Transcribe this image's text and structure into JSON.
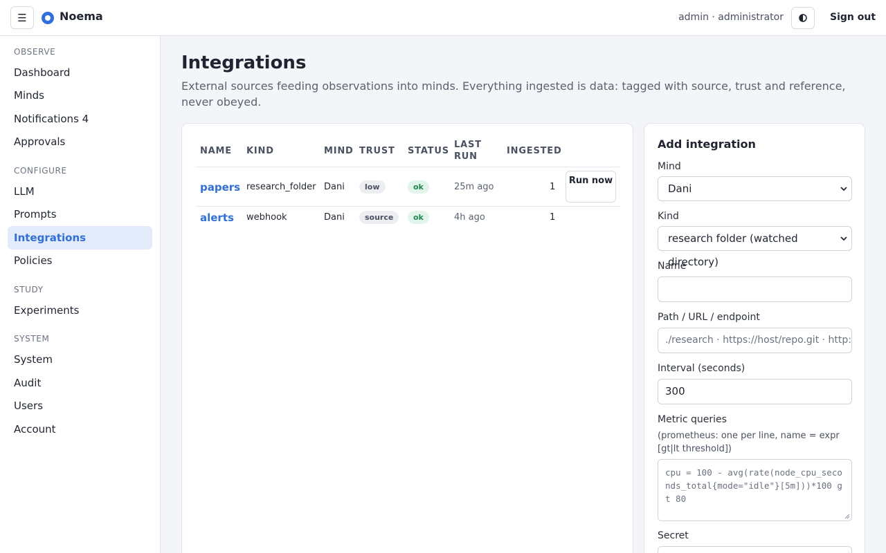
{
  "header": {
    "menu_icon": "hamburger-icon",
    "brand": "Noema",
    "user": "admin · administrator",
    "theme_icon": "contrast-icon",
    "sign_out": "Sign out"
  },
  "sidebar": {
    "sections": [
      {
        "title": "OBSERVE",
        "items": [
          "Dashboard",
          "Minds",
          "Notifications 4",
          "Approvals"
        ]
      },
      {
        "title": "CONFIGURE",
        "items": [
          "LLM",
          "Prompts",
          "Integrations",
          "Policies"
        ]
      },
      {
        "title": "STUDY",
        "items": [
          "Experiments"
        ]
      },
      {
        "title": "SYSTEM",
        "items": [
          "System",
          "Audit",
          "Users",
          "Account"
        ]
      }
    ],
    "active": "Integrations"
  },
  "page": {
    "title": "Integrations",
    "description": "External sources feeding observations into minds. Everything ingested is data: tagged with source, trust and reference, never obeyed."
  },
  "table": {
    "headers": [
      "NAME",
      "KIND",
      "MIND",
      "TRUST",
      "STATUS",
      "LAST RUN",
      "INGESTED"
    ],
    "rows": [
      {
        "name": "papers",
        "kind": "research_folder",
        "mind": "Dani",
        "trust": "low",
        "status": "ok",
        "last_run": "25m ago",
        "ingested": "1",
        "action": "Run now"
      },
      {
        "name": "alerts",
        "kind": "webhook",
        "mind": "Dani",
        "trust": "source",
        "status": "ok",
        "last_run": "4h ago",
        "ingested": "1"
      }
    ]
  },
  "form": {
    "title": "Add integration",
    "mind_label": "Mind",
    "mind_value": "Dani",
    "kind_label": "Kind",
    "kind_value": "research folder (watched directory)",
    "name_label": "Name",
    "name_value": "",
    "path_label": "Path / URL / endpoint",
    "path_placeholder": "./research · https://host/repo.git · http://",
    "interval_label": "Interval (seconds)",
    "interval_value": "300",
    "metric_label": "Metric queries",
    "metric_hint": "(prometheus: one per line, name = expr [gt|lt threshold])",
    "metric_placeholder": "cpu = 100 - avg(rate(node_cpu_seconds_total{mode=\"idle\"}[5m]))*100 gt 80",
    "secret_label": "Secret"
  },
  "colors": {
    "accent": "#2f6fe0",
    "ok_bg": "#e1f5ea",
    "ok_text": "#1e8a4e",
    "active_nav_bg": "#e4ecfb"
  }
}
